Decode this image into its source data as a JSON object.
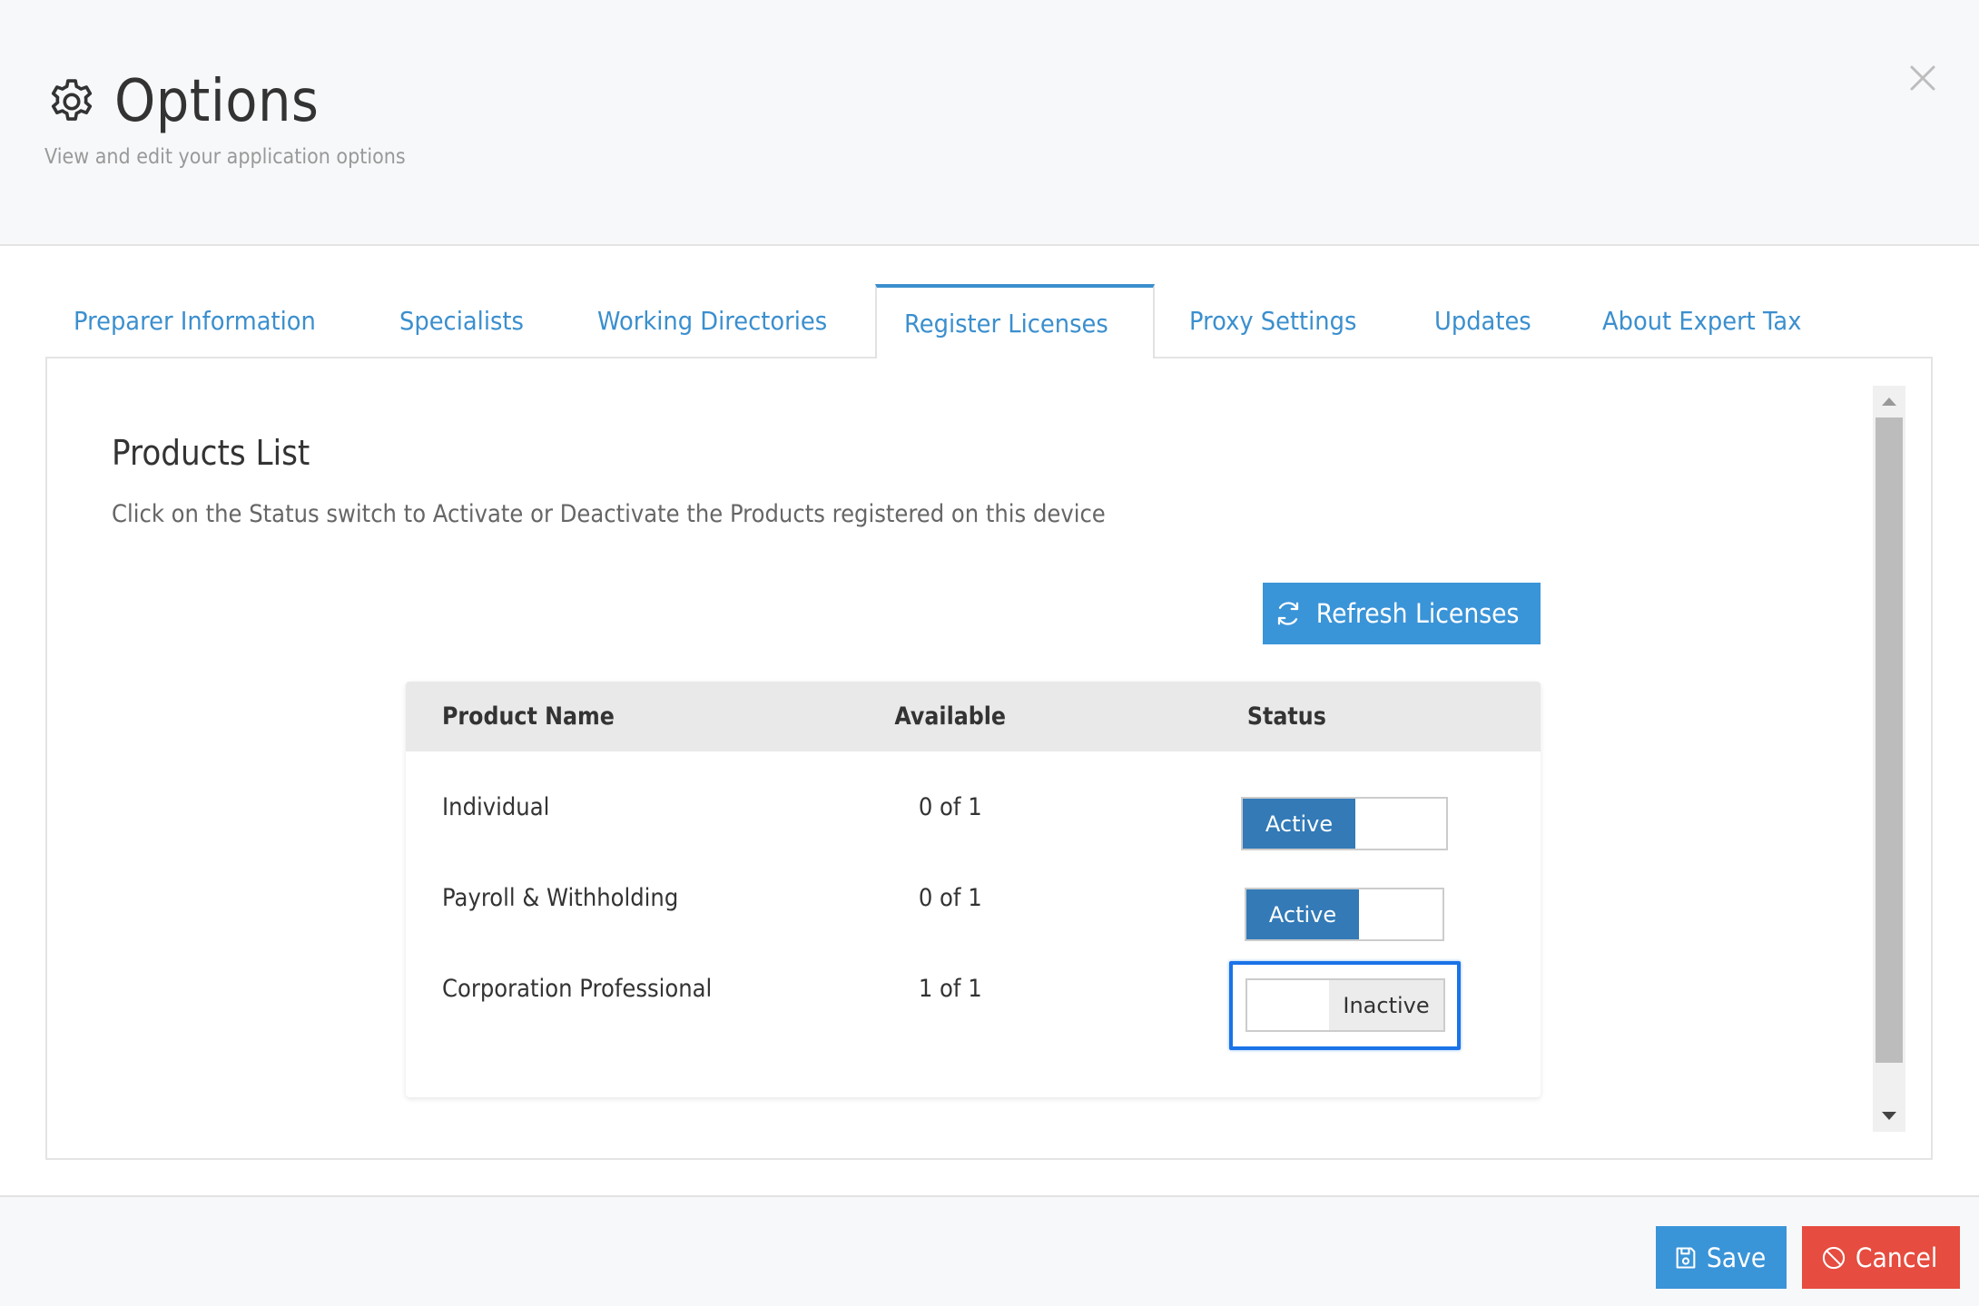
{
  "header": {
    "title": "Options",
    "subtitle": "View and edit your application options",
    "title_icon": "gear-icon",
    "close_icon": "close-icon"
  },
  "tabs": [
    {
      "label": "Preparer Information",
      "active": false
    },
    {
      "label": "Specialists",
      "active": false
    },
    {
      "label": "Working Directories",
      "active": false
    },
    {
      "label": "Register Licenses",
      "active": true
    },
    {
      "label": "Proxy Settings",
      "active": false
    },
    {
      "label": "Updates",
      "active": false
    },
    {
      "label": "About Expert Tax",
      "active": false
    }
  ],
  "products": {
    "title": "Products List",
    "description": "Click on the Status switch to Activate or Deactivate the Products registered on this device",
    "refresh_button": {
      "label": "Refresh Licenses",
      "icon": "refresh-icon"
    },
    "columns": [
      "Product Name",
      "Available",
      "Status"
    ],
    "rows": [
      {
        "name": "Individual",
        "available": "0 of 1",
        "status": "Active"
      },
      {
        "name": "Payroll & Withholding",
        "available": "0 of 1",
        "status": "Active"
      },
      {
        "name": "Corporation Professional",
        "available": "1 of 1",
        "status": "Inactive"
      }
    ]
  },
  "footer": {
    "save_label": "Save",
    "save_icon": "save-icon",
    "cancel_label": "Cancel",
    "cancel_icon": "ban-icon"
  },
  "colors": {
    "accent": "#3a94d8",
    "switch_active": "#337ab7",
    "cancel": "#e64c3f",
    "focus": "#1a73e8",
    "tab_text": "#3b8fce"
  }
}
